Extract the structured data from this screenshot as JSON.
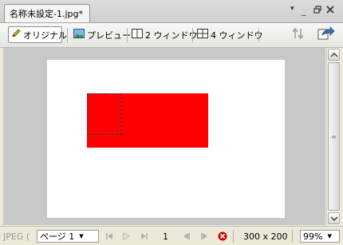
{
  "tab": {
    "title": "名称未設定-1.jpg*"
  },
  "window_controls": {
    "minimize": "_",
    "restore": "🗗",
    "close": "✕",
    "dropdown": "▾"
  },
  "toolbar": {
    "original_label": "オリジナル",
    "preview_label": "プレビュー",
    "two_window_label": "2 ウィンドウ",
    "four_window_label": "4 ウィンドウ"
  },
  "statusbar": {
    "format": "JPEG (",
    "page_select": "ページ 1",
    "page_number": "1",
    "dimensions": "300 x 200",
    "zoom": "99%"
  },
  "colors": {
    "canvas_bg": "#c8c8c8",
    "document": "#ffffff",
    "shape": "#ff0000",
    "stop": "#d40000"
  }
}
